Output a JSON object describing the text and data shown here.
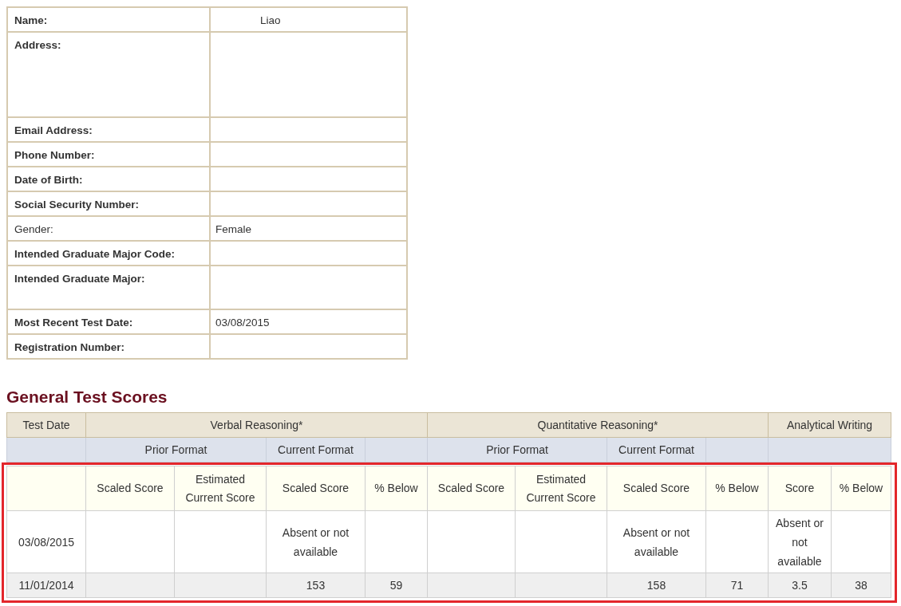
{
  "profile": {
    "rows": [
      {
        "label": "Name:",
        "value": "Liao",
        "bold": true,
        "kind": "single"
      },
      {
        "label": "Address:",
        "bold": true,
        "kind": "multiline"
      },
      {
        "label": "Email Address:",
        "bold": true,
        "kind": "single"
      },
      {
        "label": "Phone Number:",
        "bold": true,
        "kind": "single"
      },
      {
        "label": "Date of Birth:",
        "bold": true,
        "kind": "single"
      },
      {
        "label": "Social Security Number:",
        "bold": true,
        "kind": "single"
      },
      {
        "label": "Gender:",
        "value": "Female",
        "bold": false,
        "kind": "single"
      },
      {
        "label": "Intended Graduate Major Code:",
        "bold": true,
        "kind": "single"
      },
      {
        "label": "Intended Graduate Major:",
        "bold": true,
        "kind": "multiline"
      },
      {
        "label": "Most Recent Test Date:",
        "value": "03/08/2015",
        "bold": true,
        "kind": "single"
      },
      {
        "label": "Registration Number:",
        "bold": true,
        "kind": "single"
      }
    ]
  },
  "scores": {
    "title": "General Test Scores",
    "sections": [
      "Test Date",
      "Verbal Reasoning*",
      "Quantitative Reasoning*",
      "Analytical Writing"
    ],
    "formats": [
      {
        "kind": "blank"
      },
      {
        "kind": "text",
        "text": "Prior Format"
      },
      {
        "kind": "text",
        "text": "Current Format"
      },
      {
        "kind": "blank"
      },
      {
        "kind": "text",
        "text": "Prior Format"
      },
      {
        "kind": "text",
        "text": "Current Format"
      },
      {
        "kind": "blank"
      },
      {
        "kind": "blank"
      }
    ],
    "columns": [
      {
        "kind": "blank"
      },
      {
        "kind": "text",
        "text": "Scaled Score"
      },
      {
        "kind": "text",
        "text": "Estimated Current Score"
      },
      {
        "kind": "text",
        "text": "Scaled Score"
      },
      {
        "kind": "text",
        "text": "% Below"
      },
      {
        "kind": "text",
        "text": "Scaled Score"
      },
      {
        "kind": "text",
        "text": "Estimated Current Score"
      },
      {
        "kind": "text",
        "text": "Scaled Score"
      },
      {
        "kind": "text",
        "text": "% Below"
      },
      {
        "kind": "text",
        "text": "Score"
      },
      {
        "kind": "text",
        "text": "% Below"
      }
    ],
    "rows": [
      [
        {
          "kind": "text",
          "text": "03/08/2015"
        },
        {
          "kind": "blank"
        },
        {
          "kind": "blank"
        },
        {
          "kind": "text",
          "text": "Absent or not available"
        },
        {
          "kind": "blank"
        },
        {
          "kind": "blank"
        },
        {
          "kind": "blank"
        },
        {
          "kind": "text",
          "text": "Absent or not available"
        },
        {
          "kind": "blank"
        },
        {
          "kind": "text",
          "text": "Absent or not available"
        },
        {
          "kind": "blank"
        }
      ],
      [
        {
          "kind": "text",
          "text": "11/01/2014"
        },
        {
          "kind": "blank"
        },
        {
          "kind": "blank"
        },
        {
          "kind": "text",
          "text": "153"
        },
        {
          "kind": "text",
          "text": "59"
        },
        {
          "kind": "blank"
        },
        {
          "kind": "blank"
        },
        {
          "kind": "text",
          "text": "158"
        },
        {
          "kind": "text",
          "text": "71"
        },
        {
          "kind": "text",
          "text": "3.5"
        },
        {
          "kind": "text",
          "text": "38"
        }
      ]
    ]
  }
}
